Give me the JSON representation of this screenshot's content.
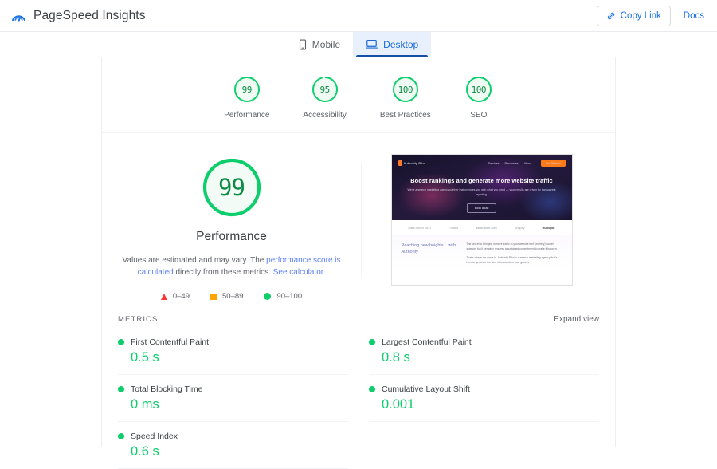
{
  "header": {
    "brand_title": "PageSpeed Insights",
    "logo_icon": "pagespeed-gauge-icon",
    "copy_link_label": "Copy Link",
    "copy_link_icon": "link-icon",
    "docs_label": "Docs"
  },
  "tabs": [
    {
      "label": "Mobile",
      "icon": "mobile-phone-icon",
      "active": false
    },
    {
      "label": "Desktop",
      "icon": "desktop-laptop-icon",
      "active": true
    }
  ],
  "scores": [
    {
      "label": "Performance",
      "value": "99"
    },
    {
      "label": "Accessibility",
      "value": "95"
    },
    {
      "label": "Best Practices",
      "value": "100"
    },
    {
      "label": "SEO",
      "value": "100"
    }
  ],
  "performance": {
    "value": "99",
    "title": "Performance",
    "note_part1": "Values are estimated and may vary. The ",
    "note_link1": "performance score is calculated",
    "note_part2": " directly from these metrics. ",
    "note_link2": "See calculator.",
    "legend": [
      {
        "shape": "triangle",
        "range": "0–49",
        "color": "#ff3333"
      },
      {
        "shape": "square",
        "range": "50–89",
        "color": "#ffa400"
      },
      {
        "shape": "circle",
        "range": "90–100",
        "color": "#0cce6b"
      }
    ]
  },
  "thumbnail": {
    "site_logo": "Authority Pilot",
    "nav_items": [
      "Services",
      "Resources",
      "About"
    ],
    "cta_label": "Get Started",
    "hero_heading": "Boost rankings and generate more website traffic",
    "hero_sub": "We're a search marketing agency partner that provides you with what you need — your results are driven by transparent reporting.",
    "hero_button": "Book a call",
    "logos_caption": "Data driven SEO",
    "logos": [
      "Forbes",
      "datainsider.com",
      "Shopify",
      "HubSpot"
    ],
    "lower_heading": "Reaching new heights ...with Authority",
    "lower_p1": "The secret to bringing in more traffic to your website isn't (entirely) rocket science, but it certainly requires a sustained commitment to make it happen.",
    "lower_p2": "That's where we come in. Authority Pilot is a search marketing agency that's here to generate the kind of momentum your growth."
  },
  "metrics_section": {
    "title": "METRICS",
    "expand_label": "Expand view",
    "items": [
      {
        "name": "First Contentful Paint",
        "value": "0.5 s",
        "status_color": "#0cce6b"
      },
      {
        "name": "Largest Contentful Paint",
        "value": "0.8 s",
        "status_color": "#0cce6b"
      },
      {
        "name": "Total Blocking Time",
        "value": "0 ms",
        "status_color": "#0cce6b"
      },
      {
        "name": "Cumulative Layout Shift",
        "value": "0.001",
        "status_color": "#0cce6b"
      },
      {
        "name": "Speed Index",
        "value": "0.6 s",
        "status_color": "#0cce6b"
      }
    ]
  },
  "colors": {
    "accent_blue": "#1a73e8",
    "tab_active_bg": "#e8f0fe",
    "tab_indicator": "#174ea6",
    "green": "#0cce6b",
    "green_text": "#0c8c43",
    "orange": "#ffa400",
    "red": "#ff3333"
  }
}
